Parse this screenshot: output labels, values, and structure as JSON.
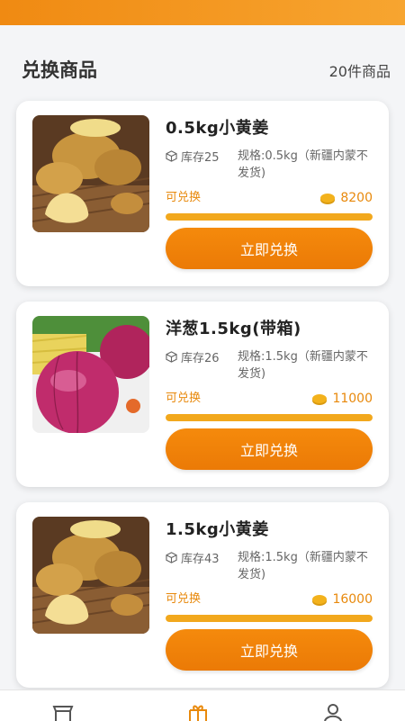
{
  "section": {
    "title": "兑换商品",
    "count": "20件商品"
  },
  "products": [
    {
      "name": "0.5kg小黄姜",
      "stock": "库存25",
      "spec": "规格:0.5kg（新疆内蒙不发货)",
      "status": "可兑换",
      "price": "8200",
      "progress": 1.0,
      "button": "立即兑换",
      "image": "ginger"
    },
    {
      "name": "洋葱1.5kg(带箱)",
      "stock": "库存26",
      "spec": "规格:1.5kg（新疆内蒙不发货)",
      "status": "可兑换",
      "price": "11000",
      "progress": 1.0,
      "button": "立即兑换",
      "image": "onion"
    },
    {
      "name": "1.5kg小黄姜",
      "stock": "库存43",
      "spec": "规格:1.5kg（新疆内蒙不发货)",
      "status": "可兑换",
      "price": "16000",
      "progress": 1.0,
      "button": "立即兑换",
      "image": "ginger"
    }
  ],
  "tabbar": {
    "icons": [
      "shop-icon",
      "gift-icon",
      "user-icon"
    ]
  },
  "colors": {
    "accent": "#f08a12",
    "coin": "#f3b21c",
    "progress": "#f2a81d"
  }
}
